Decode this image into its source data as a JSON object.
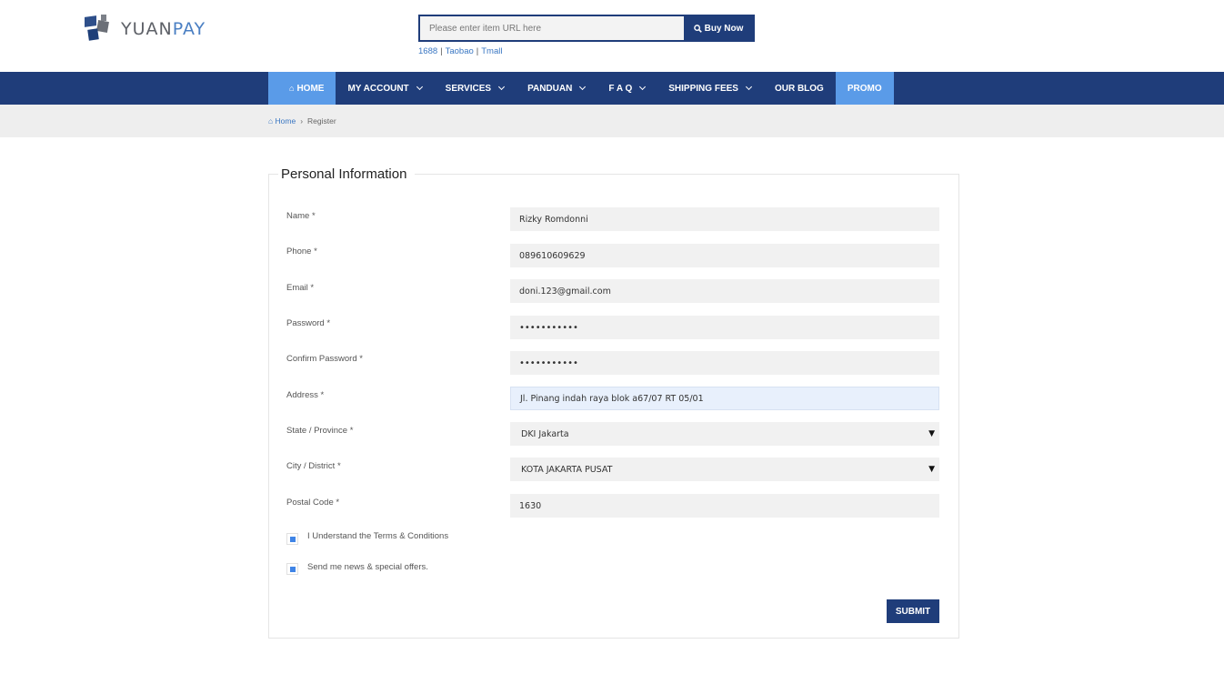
{
  "brand": {
    "part1": "YUAN",
    "part2": "PAY",
    "accent": "#1f3d7a",
    "highlight": "#5a9be8"
  },
  "search": {
    "placeholder": "Please enter item URL here",
    "button_label": "Buy Now",
    "button_icon": "search-icon"
  },
  "markets": [
    "1688",
    "Taobao",
    "Tmall"
  ],
  "nav": {
    "home": "HOME",
    "items": [
      "MY ACCOUNT",
      "SERVICES",
      "PANDUAN",
      "F A Q",
      "SHIPPING FEES",
      "OUR BLOG",
      "PROMO"
    ]
  },
  "breadcrumb": {
    "home": "Home",
    "current": "Register"
  },
  "form": {
    "title": "Personal Information",
    "fields": {
      "name": {
        "label": "Name *",
        "value": "Rizky Romdonni"
      },
      "phone": {
        "label": "Phone *",
        "value": "089610609629"
      },
      "email": {
        "label": "Email *",
        "value": "doni.123@gmail.com"
      },
      "password": {
        "label": "Password *",
        "value": "•••••••••••"
      },
      "confirm_password": {
        "label": "Confirm Password *",
        "value": "•••••••••••"
      },
      "address": {
        "label": "Address *",
        "value": "Jl. Pinang indah raya blok a67/07 RT 05/01"
      },
      "state": {
        "label": "State / Province *",
        "value": "DKI Jakarta"
      },
      "city": {
        "label": "City / District *",
        "value": "KOTA JAKARTA PUSAT"
      },
      "postal": {
        "label": "Postal Code *",
        "value": "1630"
      }
    },
    "terms_label": "I Understand the Terms & Conditions",
    "terms_checked": true,
    "news_label": "Send me news & special offers.",
    "news_checked": true,
    "submit_label": "SUBMIT"
  }
}
